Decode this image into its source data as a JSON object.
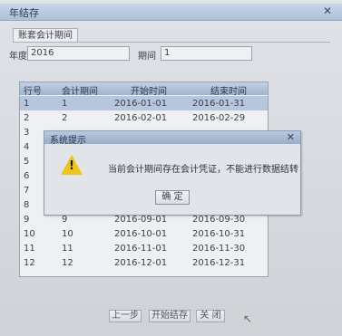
{
  "window": {
    "title": "年结存",
    "close_icon": "close-icon"
  },
  "tab": {
    "label": "账套会计期间"
  },
  "fields": {
    "year_label": "年度",
    "year_value": "2016",
    "period_label": "期间",
    "period_value": "1"
  },
  "table": {
    "columns": [
      "行号",
      "会计期间",
      "开始时间",
      "结束时间"
    ],
    "rows": [
      {
        "no": "1",
        "period": "1",
        "start": "2016-01-01",
        "end": "2016-01-31"
      },
      {
        "no": "2",
        "period": "2",
        "start": "2016-02-01",
        "end": "2016-02-29"
      },
      {
        "no": "3",
        "period": "",
        "start": "",
        "end": ""
      },
      {
        "no": "4",
        "period": "",
        "start": "",
        "end": ""
      },
      {
        "no": "5",
        "period": "",
        "start": "",
        "end": ""
      },
      {
        "no": "6",
        "period": "",
        "start": "",
        "end": ""
      },
      {
        "no": "7",
        "period": "",
        "start": "",
        "end": ""
      },
      {
        "no": "8",
        "period": "",
        "start": "",
        "end": ""
      },
      {
        "no": "9",
        "period": "9",
        "start": "2016-09-01",
        "end": "2016-09-30"
      },
      {
        "no": "10",
        "period": "10",
        "start": "2016-10-01",
        "end": "2016-10-31"
      },
      {
        "no": "11",
        "period": "11",
        "start": "2016-11-01",
        "end": "2016-11-30"
      },
      {
        "no": "12",
        "period": "12",
        "start": "2016-12-01",
        "end": "2016-12-31"
      }
    ]
  },
  "dialog": {
    "title": "系统提示",
    "message": "当前会计期间存在会计凭证，不能进行数据结转",
    "ok": "确 定",
    "icon": "warning-icon"
  },
  "buttons": {
    "prev": "上一步",
    "start": "开始结存",
    "close": "关 闭"
  },
  "colors": {
    "selected_row": "#b6c6dc",
    "warning": "#f0c419"
  }
}
